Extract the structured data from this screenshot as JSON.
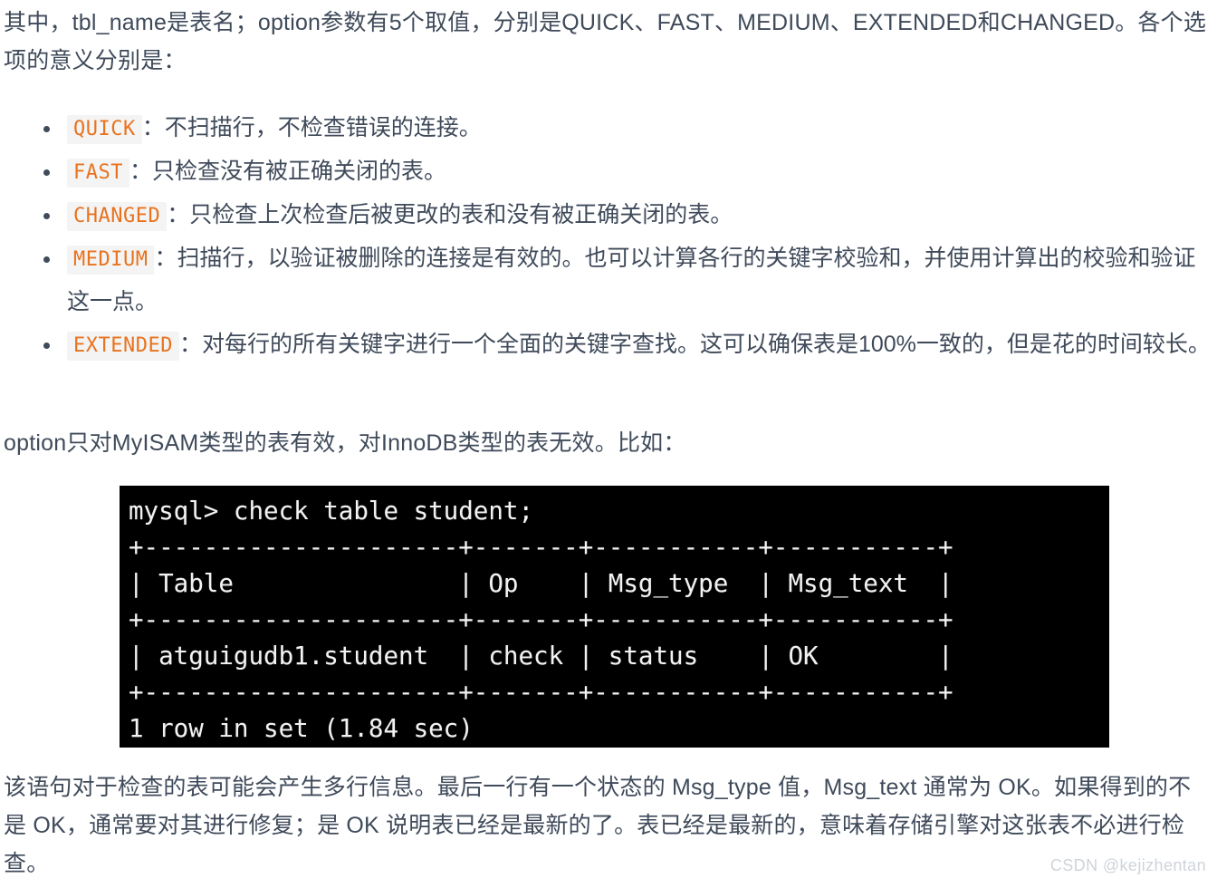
{
  "article": {
    "intro_paragraph": "其中，tbl_name是表名；option参数有5个取值，分别是QUICK、FAST、MEDIUM、EXTENDED和CHANGED。各个选项的意义分别是：",
    "option_paragraph": "option只对MyISAM类型的表有效，对InnoDB类型的表无效。比如：",
    "tail_paragraph": "该语句对于检查的表可能会产生多行信息。最后一行有一个状态的 Msg_type 值，Msg_text 通常为 OK。如果得到的不是 OK，通常要对其进行修复；是 OK 说明表已经是最新的了。表已经是最新的，意味着存储引擎对这张表不必进行检查。",
    "options": [
      {
        "code": "QUICK",
        "description": "：不扫描行，不检查错误的连接。"
      },
      {
        "code": "FAST",
        "description": "：只检查没有被正确关闭的表。"
      },
      {
        "code": "CHANGED",
        "description": "：只检查上次检查后被更改的表和没有被正确关闭的表。"
      },
      {
        "code": "MEDIUM",
        "description": "：扫描行，以验证被删除的连接是有效的。也可以计算各行的关键字校验和，并使用计算出的校验和验证这一点。"
      },
      {
        "code": "EXTENDED",
        "description": "：对每行的所有关键字进行一个全面的关键字查找。这可以确保表是100%一致的，但是花的时间较长。"
      }
    ]
  },
  "terminal": {
    "prompt": "mysql>",
    "command": "check table student;",
    "output_text": "mysql> check table student;\n+---------------------+-------+-----------+-----------+\n| Table               | Op    | Msg_type  | Msg_text  |\n+---------------------+-------+-----------+-----------+\n| atguigudb1.student  | check | status    | OK        |\n+---------------------+-------+-----------+-----------+\n1 row in set (1.84 sec)",
    "result_table": {
      "columns": [
        "Table",
        "Op",
        "Msg_type",
        "Msg_text"
      ],
      "rows": [
        [
          "atguigudb1.student",
          "check",
          "status",
          "OK"
        ]
      ]
    },
    "footer": "1 row in set (1.84 sec)",
    "background_color": "#000000",
    "text_color": "#f2f2f2"
  },
  "watermark": {
    "text": "CSDN @kejizhentan"
  },
  "theme": {
    "body_text_color": "#3f4a5a",
    "inline_code_color": "#e8731f",
    "inline_code_background": "#f4f4f4",
    "page_background": "#ffffff"
  }
}
